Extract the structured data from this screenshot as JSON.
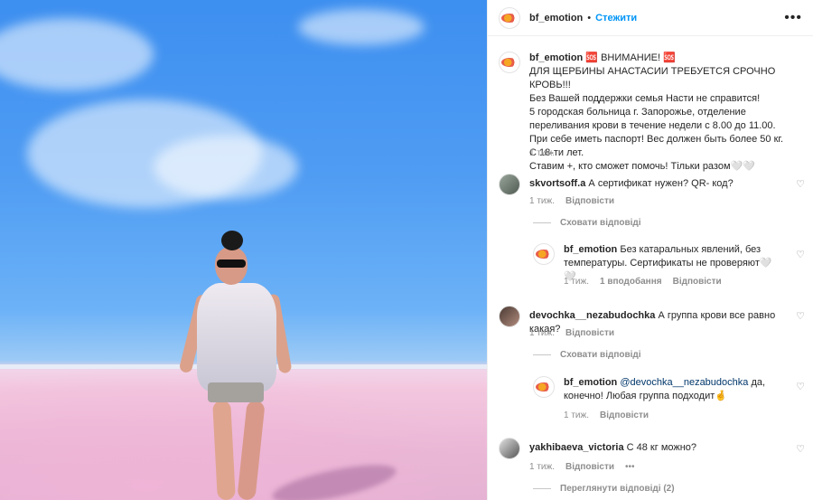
{
  "post": {
    "username": "bf_emotion",
    "follow_label": "Стежити",
    "more_icon": "more-options-icon"
  },
  "caption": {
    "username": "bf_emotion",
    "text": "🆘 ВНИМАНИЕ! 🆘\nДЛЯ ЩЕРБИНЫ АНАСТАСИИ ТРЕБУЕТСЯ СРОЧНО КРОВЬ!!!\nБез Вашей поддержки семья Насти не справится!\n5 городская больница г. Запорожье, отделение переливания крови в течение недели с 8.00 до 11.00. При себе иметь паспорт! Вес должен быть более 50 кг. С 18-ти лет.\nСтавим +, кто сможет помочь! Тільки разом🤍🤍",
    "time": "1 тиж."
  },
  "comments": [
    {
      "username": "skvortsoff.a",
      "text": "А сертификат нужен? QR- код?",
      "time": "1 тиж.",
      "reply_label": "Відповісти",
      "toggle_label": "Сховати відповіді",
      "reply": {
        "username": "bf_emotion",
        "text": "Без катаральных явлений, без температуры. Сертификаты не проверяют🤍🤍",
        "time": "1 тиж.",
        "likes": "1 вподобання",
        "reply_label": "Відповісти"
      }
    },
    {
      "username": "devochka__nezabudochka",
      "text": "А группа крови все равно какая?",
      "time": "1 тиж.",
      "reply_label": "Відповісти",
      "toggle_label": "Сховати відповіді",
      "reply": {
        "username": "bf_emotion",
        "mention": "@devochka__nezabudochka",
        "text": " да, конечно! Любая группа подходит🤞",
        "time": "1 тиж.",
        "reply_label": "Відповісти"
      }
    },
    {
      "username": "yakhibaeva_victoria",
      "text": "С 48 кг можно?",
      "time": "1 тиж.",
      "reply_label": "Відповісти",
      "toggle_label": "Переглянути відповіді (2)"
    }
  ],
  "icons": {
    "like": "heart-icon",
    "more": "more-options-icon"
  }
}
